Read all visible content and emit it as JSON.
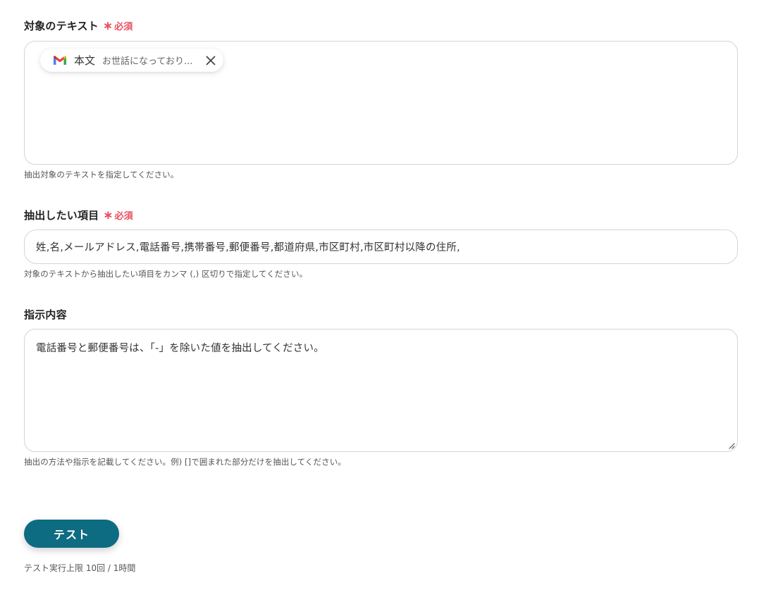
{
  "target_text": {
    "label": "対象のテキスト",
    "required_label": "必須",
    "chip": {
      "name": "本文",
      "preview": "お世話になっており..."
    },
    "help": "抽出対象のテキストを指定してください。"
  },
  "extract_items": {
    "label": "抽出したい項目",
    "required_label": "必須",
    "value": "姓,名,メールアドレス,電話番号,携帯番号,郵便番号,都道府県,市区町村,市区町村以降の住所,",
    "help": "対象のテキストから抽出したい項目をカンマ (,) 区切りで指定してください。"
  },
  "instructions": {
    "label": "指示内容",
    "value": "電話番号と郵便番号は、「-」を除いた値を抽出してください。",
    "help": "抽出の方法や指示を記載してください。例) []で囲まれた部分だけを抽出してください。"
  },
  "test_button": {
    "label": "テスト"
  },
  "limit_text": "テスト実行上限 10回 / 1時間",
  "colors": {
    "required": "#e8515e",
    "button": "#0d6b82",
    "border": "#cfd6dc"
  },
  "icons": {
    "chip_icon": "gmail-icon",
    "chip_close": "close-icon",
    "required_mark": "asterisk"
  }
}
